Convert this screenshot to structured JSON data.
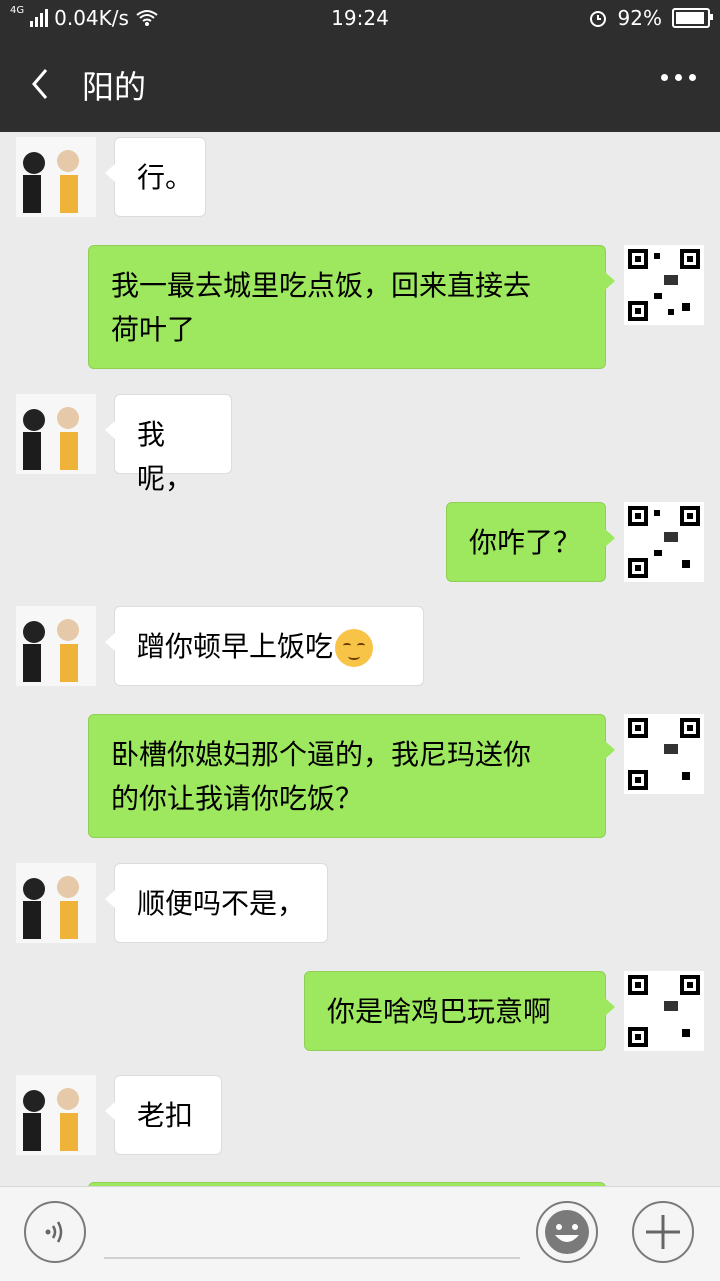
{
  "status_bar": {
    "network": "4G",
    "speed": "0.04K/s",
    "time": "19:24",
    "battery": "92%",
    "battery_level": 0.92
  },
  "header": {
    "title": "阳的",
    "back_icon": "chevron-left-icon",
    "more_icon": "more-icon"
  },
  "messages": [
    {
      "side": "in",
      "text": "行。"
    },
    {
      "side": "out",
      "lines": [
        "我一最去城里吃点饭，回来直接去",
        "荷叶了"
      ]
    },
    {
      "side": "in",
      "text": "我呢，"
    },
    {
      "side": "out",
      "text": "你咋了？"
    },
    {
      "side": "in",
      "text": "蹭你顿早上饭吃",
      "emoji": "relieved-face-emoji"
    },
    {
      "side": "out",
      "lines": [
        "卧槽你媳妇那个逼的，我尼玛送你",
        "的你让我请你吃饭？"
      ]
    },
    {
      "side": "in",
      "text": "顺便吗不是，"
    },
    {
      "side": "out",
      "text": "你是啥鸡巴玩意啊"
    },
    {
      "side": "in",
      "text": "老扣"
    }
  ],
  "input_bar": {
    "voice_icon": "voice-icon",
    "emoji_icon": "smile-icon",
    "plus_icon": "plus-icon"
  }
}
